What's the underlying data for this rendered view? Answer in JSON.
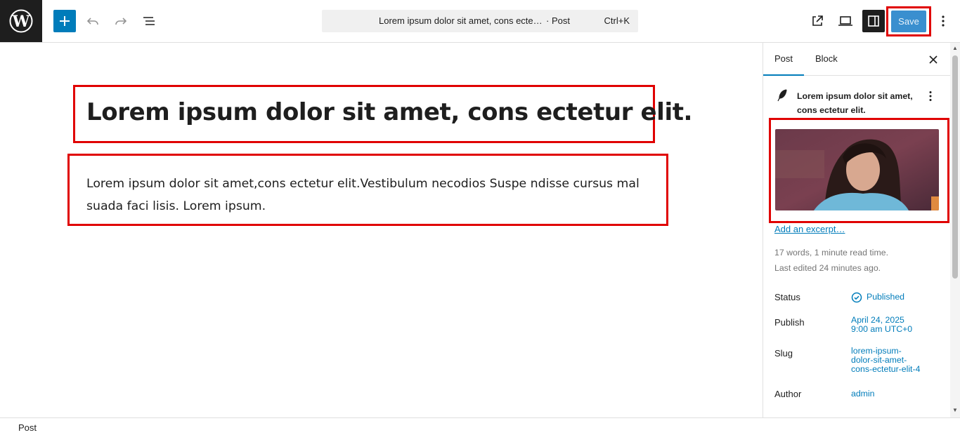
{
  "toolbar": {
    "command_title": "Lorem ipsum dolor sit amet, cons ecte…",
    "command_type": "· Post",
    "command_shortcut": "Ctrl+K",
    "save_label": "Save"
  },
  "editor": {
    "post_title": "Lorem ipsum dolor sit amet, cons ectetur elit.",
    "paragraph": "Lorem ipsum dolor sit amet,cons ectetur elit.Vestibulum necodios Suspe ndisse cursus mal suada faci lisis. Lorem ipsum."
  },
  "sidebar": {
    "tabs": [
      "Post",
      "Block"
    ],
    "post_card_title": "Lorem ipsum dolor sit amet, cons ectetur elit.",
    "excerpt_link": "Add an excerpt…",
    "stats": "17 words, 1 minute read time.",
    "last_edited": "Last edited 24 minutes ago.",
    "rows": [
      {
        "label": "Status",
        "value": "Published"
      },
      {
        "label": "Publish",
        "value": "April 24, 2025\n9:00 am UTC+0"
      },
      {
        "label": "Slug",
        "value": "lorem-ipsum-\ndolor-sit-amet-\ncons-ectetur-elit-4"
      },
      {
        "label": "Author",
        "value": "admin"
      }
    ]
  },
  "footer": {
    "breadcrumb": "Post"
  },
  "colors": {
    "accent": "#007cba",
    "highlight_border": "#e00000",
    "dark": "#1e1e1e"
  },
  "icons": [
    "wordpress-logo-icon",
    "plus-icon",
    "undo-icon",
    "redo-icon",
    "list-view-icon",
    "external-link-icon",
    "desktop-preview-icon",
    "sidebar-toggle-icon",
    "more-vertical-icon",
    "close-icon",
    "feather-icon",
    "check-circle-icon"
  ]
}
